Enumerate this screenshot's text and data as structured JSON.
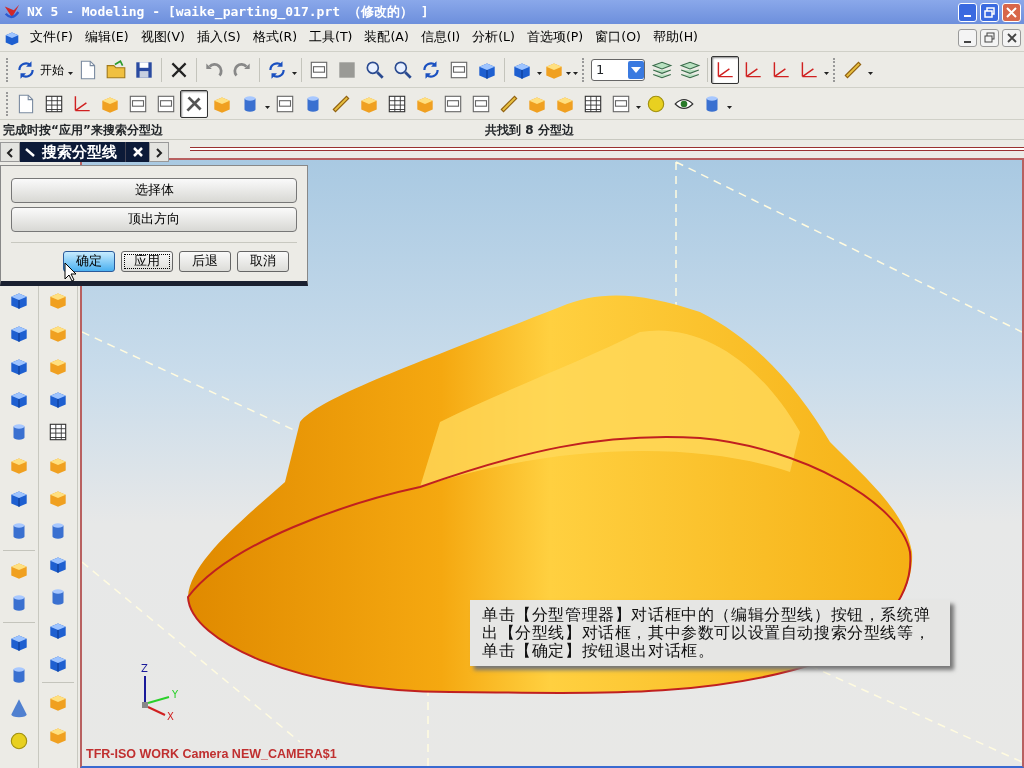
{
  "window": {
    "title": "NX 5 - Modeling - [waike_parting_017.prt （修改的） ]"
  },
  "menu": [
    "文件(F)",
    "编辑(E)",
    "视图(V)",
    "插入(S)",
    "格式(R)",
    "工具(T)",
    "装配(A)",
    "信息(I)",
    "分析(L)",
    "首选项(P)",
    "窗口(O)",
    "帮助(H)"
  ],
  "toolbar_1": [
    {
      "kind": "start",
      "label": "开始"
    },
    {
      "kind": "icon",
      "pressed": false
    },
    {
      "kind": "icon",
      "pressed": false
    },
    {
      "kind": "icon",
      "pressed": false
    },
    {
      "kind": "icon",
      "pressed": false
    },
    {
      "kind": "icon",
      "pressed": false
    },
    {
      "kind": "icon",
      "pressed": false
    },
    {
      "kind": "icon",
      "pressed": false
    },
    {
      "kind": "icon",
      "pressed": false
    },
    {
      "kind": "icon",
      "pressed": false
    },
    {
      "kind": "icon",
      "pressed": false
    },
    {
      "kind": "icon",
      "pressed": false
    },
    {
      "kind": "icon",
      "pressed": false
    },
    {
      "kind": "icon",
      "pressed": false
    },
    {
      "kind": "icon",
      "pressed": false
    },
    {
      "kind": "icon",
      "pressed": false
    },
    {
      "kind": "layer_select",
      "value": "1"
    },
    {
      "kind": "icon",
      "pressed": false
    },
    {
      "kind": "icon",
      "pressed": false
    },
    {
      "kind": "icon",
      "pressed": true
    },
    {
      "kind": "icon",
      "pressed": false
    },
    {
      "kind": "icon",
      "pressed": false
    },
    {
      "kind": "icon",
      "pressed": false
    },
    {
      "kind": "icon",
      "pressed": false
    }
  ],
  "toolbar_2": [
    {
      "pressed": false
    },
    {
      "pressed": false
    },
    {
      "pressed": false
    },
    {
      "pressed": false
    },
    {
      "pressed": false
    },
    {
      "pressed": false
    },
    {
      "pressed": true
    },
    {
      "pressed": false
    },
    {
      "pressed": false
    },
    {
      "pressed": false
    },
    {
      "pressed": false
    },
    {
      "pressed": false
    },
    {
      "pressed": false
    },
    {
      "pressed": false
    },
    {
      "pressed": false
    },
    {
      "pressed": false
    },
    {
      "pressed": false
    },
    {
      "pressed": false
    },
    {
      "pressed": false
    },
    {
      "pressed": false
    },
    {
      "pressed": false
    },
    {
      "pressed": false
    },
    {
      "pressed": false
    },
    {
      "pressed": false
    },
    {
      "pressed": false
    }
  ],
  "status": {
    "prompt": "完成时按“应用”来搜索分型边",
    "message": "共找到 8 分型边"
  },
  "dialog": {
    "title": "搜索分型线",
    "wide_buttons": [
      "选择体",
      "顶出方向"
    ],
    "buttons": [
      {
        "label": "确定",
        "default": true,
        "focused": false
      },
      {
        "label": "应用",
        "default": false,
        "focused": true
      },
      {
        "label": "后退",
        "default": false,
        "focused": false
      },
      {
        "label": "取消",
        "default": false,
        "focused": false
      }
    ]
  },
  "viewport": {
    "axes": [
      "Z",
      "Y",
      "X"
    ],
    "view_label": "TFR-ISO WORK Camera NEW_CAMERA$1",
    "callout": "单击【分型管理器】对话框中的（编辑分型线）按钮，系统弹出【分型线】对话框，其中参数可以设置自动搜索分型线等，单击【确定】按钮退出对话框。"
  }
}
